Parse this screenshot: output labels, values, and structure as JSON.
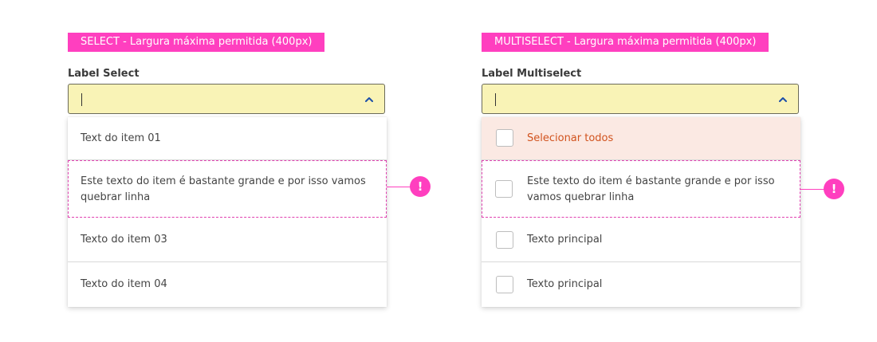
{
  "select": {
    "tag": "SELECT - Largura máxima permitida (400px)",
    "label": "Label Select",
    "input_value": "|",
    "options": [
      "Text do item 01",
      "Este texto do item é bastante grande e por isso vamos quebrar linha",
      "Texto do item 03",
      "Texto do item 04"
    ],
    "warning_icon": "!"
  },
  "multiselect": {
    "tag": "MULTISELECT - Largura máxima permitida (400px)",
    "label": "Label Multiselect",
    "input_value": "|",
    "select_all": "Selecionar todos",
    "options": [
      "Este texto do item é bastante grande e por isso vamos quebrar linha",
      "Texto principal",
      "Texto principal"
    ],
    "warning_icon": "!"
  },
  "colors": {
    "accent": "#ff3fbf",
    "field_bg": "#f9f3b6",
    "select_all_bg": "#fbe9e3",
    "select_all_text": "#d1531e",
    "chevron": "#1d4fa8"
  }
}
